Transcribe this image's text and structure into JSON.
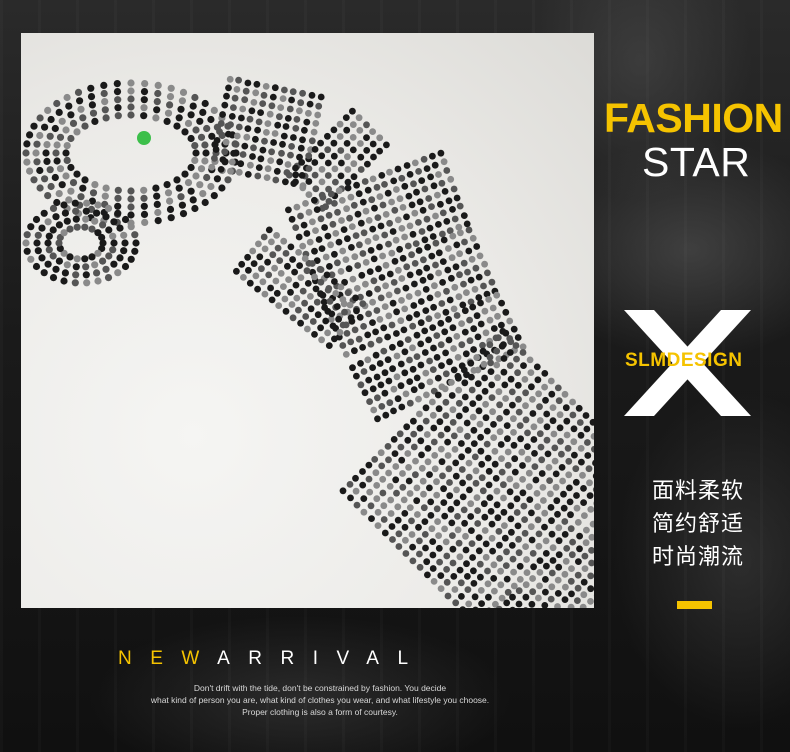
{
  "headline": {
    "line1": "FASHION",
    "line2": "STAR"
  },
  "brand": {
    "name": "SLMDESIGN",
    "mark": "X"
  },
  "features": [
    "面料柔软",
    "简约舒适",
    "时尚潮流"
  ],
  "arrival": {
    "highlight": "NEW",
    "rest": "ARRIVAL"
  },
  "tagline": [
    "Don't drift with the tide, don't be constrained by fashion. You decide",
    "what kind of person you are, what kind of clothes you wear, and what lifestyle you choose.",
    "Proper clothing is also a form of courtesy."
  ],
  "colors": {
    "accent": "#f5c300",
    "background": "#161616",
    "text": "#ffffff"
  },
  "photo": {
    "icon": "rhinestone-leopard-image"
  }
}
